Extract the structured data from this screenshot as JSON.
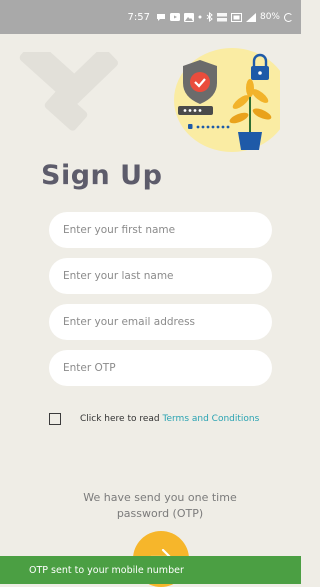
{
  "status_bar": {
    "time": "7:57",
    "battery": "80%",
    "icons": [
      "chat-bubble-icon",
      "video-icon",
      "gallery-icon",
      "dot-icon",
      "bluetooth-icon",
      "data-speed-icon",
      "volte-icon",
      "signal-icon",
      "battery-icon"
    ]
  },
  "title": "Sign Up",
  "fields": {
    "first_name": {
      "placeholder": "Enter your first name"
    },
    "last_name": {
      "placeholder": "Enter your last name"
    },
    "email": {
      "placeholder": "Enter your email address"
    },
    "otp": {
      "placeholder": "Enter OTP"
    }
  },
  "terms": {
    "prefix": "Click here to read",
    "link": "Terms and Conditions"
  },
  "otp_message": "We have send you one time password (OTP)",
  "next_button": {
    "icon": "arrow-right-icon"
  },
  "snackbar": {
    "text": "OTP sent to your mobile number"
  },
  "colors": {
    "background": "#efede6",
    "title": "#5d5c6b",
    "accent": "#f6b62b",
    "link": "#2aa3b2",
    "snackbar": "#4b9f43",
    "status_bar": "#a9a9a9"
  }
}
